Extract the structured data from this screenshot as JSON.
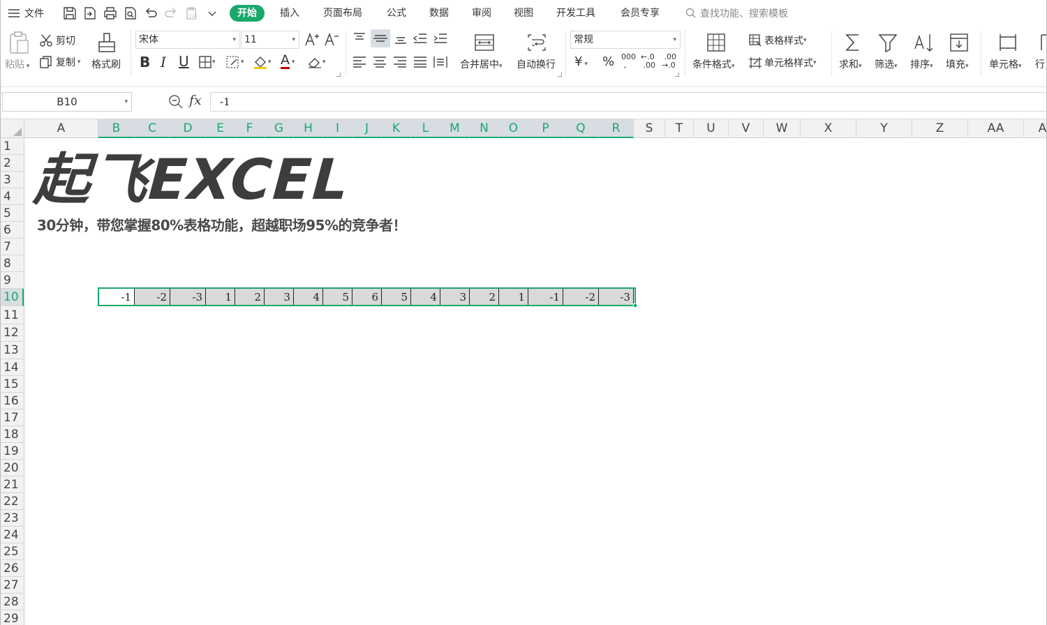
{
  "menubar": {
    "file_label": "文件",
    "tabs": [
      "开始",
      "插入",
      "页面布局",
      "公式",
      "数据",
      "审阅",
      "视图",
      "开发工具",
      "会员专享"
    ],
    "active_tab": "开始",
    "search_placeholder": "查找功能、搜索模板"
  },
  "ribbon": {
    "paste_label": "粘贴",
    "cut_label": "剪切",
    "copy_label": "复制",
    "format_painter_label": "格式刷",
    "font_name": "宋体",
    "font_size": "11",
    "bold_glyph": "B",
    "italic_glyph": "I",
    "underline_glyph": "U",
    "font_color_glyph": "A",
    "merge_label": "合并居中",
    "wrap_label": "自动换行",
    "number_format": "常规",
    "currency_glyph": "¥",
    "percent_glyph": "%",
    "thousands_glyph": "000",
    "conditional_format_label": "条件格式",
    "table_style_label": "表格样式",
    "cell_style_label": "单元格样式",
    "sum_label": "求和",
    "filter_label": "筛选",
    "sort_label": "排序",
    "fill_label": "填充",
    "cell_label": "单元格",
    "row_label": "行"
  },
  "formula_bar": {
    "name_box": "B10",
    "fx_label": "fx",
    "formula": "-1"
  },
  "columns": [
    "A",
    "B",
    "C",
    "D",
    "E",
    "F",
    "G",
    "H",
    "I",
    "J",
    "K",
    "L",
    "M",
    "N",
    "O",
    "P",
    "Q",
    "R",
    "S",
    "T",
    "U",
    "V",
    "W",
    "X",
    "Y",
    "Z",
    "AA",
    "A"
  ],
  "selected_columns": [
    "B",
    "C",
    "D",
    "E",
    "F",
    "G",
    "H",
    "I",
    "J",
    "K",
    "L",
    "M",
    "N",
    "O",
    "P",
    "Q",
    "R"
  ],
  "rows": [
    "1",
    "2",
    "3",
    "4",
    "5",
    "6",
    "7",
    "8",
    "9",
    "10",
    "11",
    "12",
    "13",
    "14",
    "15",
    "16",
    "17",
    "18",
    "19",
    "20",
    "21",
    "22",
    "23",
    "24",
    "25",
    "26",
    "27",
    "28",
    "29"
  ],
  "selected_row": "10",
  "sheet": {
    "logo_text": "起飞EXCEL",
    "subtitle": "30分钟，带您掌握80%表格功能，超越职场95%的竞争者！",
    "row10_values": [
      "-1",
      "-2",
      "-3",
      "1",
      "2",
      "3",
      "4",
      "5",
      "6",
      "5",
      "4",
      "3",
      "2",
      "1",
      "-1",
      "-2",
      "-3"
    ]
  },
  "colors": {
    "accent": "#1aa86b",
    "selected_header_bg": "#d8dde4",
    "cell_fill": "#d9d9d9"
  }
}
